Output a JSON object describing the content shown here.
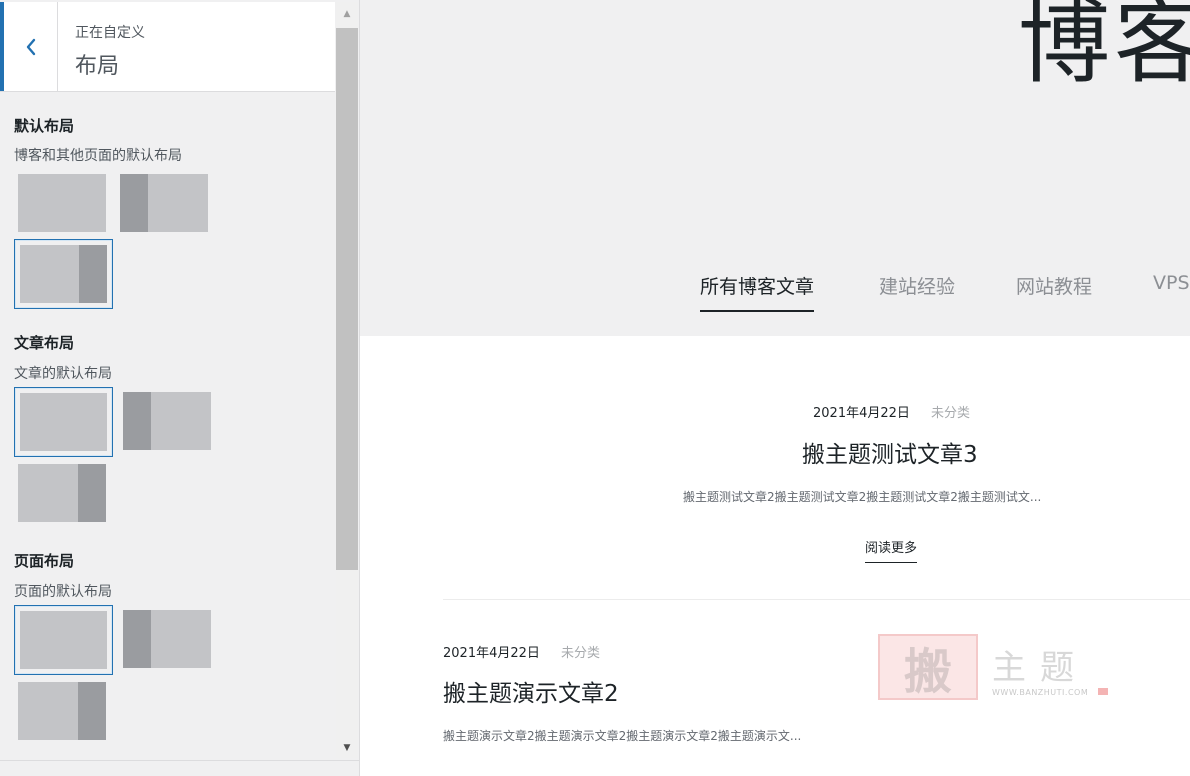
{
  "customizer": {
    "header": {
      "back_label": "‹",
      "customizing": "正在自定义",
      "section_title": "布局"
    },
    "groups": [
      {
        "title": "默认布局",
        "description": "博客和其他页面的默认布局",
        "options": [
          "full-width",
          "left-sidebar",
          "right-sidebar"
        ],
        "selected": "right-sidebar"
      },
      {
        "title": "文章布局",
        "description": "文章的默认布局",
        "options": [
          "full-width",
          "left-sidebar",
          "right-sidebar"
        ],
        "selected": "full-width"
      },
      {
        "title": "页面布局",
        "description": "页面的默认布局",
        "options": [
          "full-width",
          "left-sidebar",
          "right-sidebar"
        ],
        "selected": "full-width"
      }
    ],
    "accent_color": "#2271b1"
  },
  "preview": {
    "hero_title": "博客",
    "categories": [
      {
        "label": "所有博客文章",
        "active": true
      },
      {
        "label": "建站经验",
        "active": false
      },
      {
        "label": "网站教程",
        "active": false
      },
      {
        "label": "VPS",
        "active": false
      }
    ],
    "posts": [
      {
        "date": "2021年4月22日",
        "category": "未分类",
        "title": "搬主题测试文章3",
        "excerpt": "搬主题测试文章2搬主题测试文章2搬主题测试文章2搬主题测试文...",
        "read_more": "阅读更多"
      },
      {
        "date": "2021年4月22日",
        "category": "未分类",
        "title": "搬主题演示文章2",
        "excerpt": "搬主题演示文章2搬主题演示文章2搬主题演示文章2搬主题演示文..."
      }
    ],
    "watermark": {
      "stamp": "搬",
      "text": "主题",
      "url": "WWW.BANZHUTI.COM"
    }
  }
}
